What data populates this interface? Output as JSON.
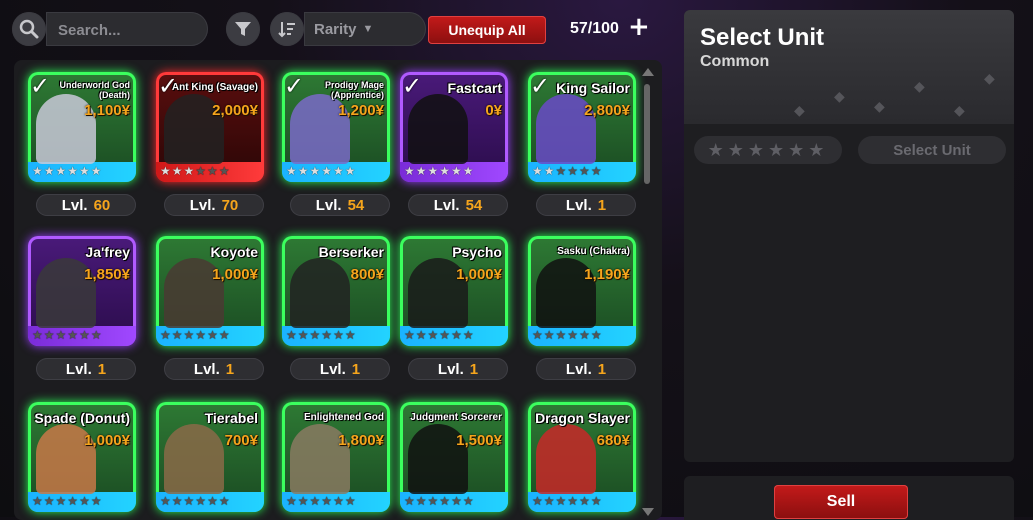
{
  "toolbar": {
    "search_placeholder": "Search...",
    "rarity_label": "Rarity",
    "unequip_label": "Unequip All",
    "count": "57/100",
    "add_label": "+"
  },
  "units": [
    {
      "name": "Underworld God (Death)",
      "price": "1,100¥",
      "level": "60",
      "rarity": "green",
      "stars_on": 6,
      "equipped": true
    },
    {
      "name": "Ant King (Savage)",
      "price": "2,000¥",
      "level": "70",
      "rarity": "red",
      "stars_on": 3,
      "equipped": true
    },
    {
      "name": "Prodigy Mage (Apprentice)",
      "price": "1,200¥",
      "level": "54",
      "rarity": "green",
      "stars_on": 6,
      "equipped": true
    },
    {
      "name": "Fastcart",
      "price": "0¥",
      "level": "54",
      "rarity": "purple",
      "stars_on": 6,
      "equipped": true
    },
    {
      "name": "King Sailor",
      "price": "2,800¥",
      "level": "1",
      "rarity": "green",
      "stars_on": 2,
      "equipped": true
    },
    {
      "name": "Ja'frey",
      "price": "1,850¥",
      "level": "1",
      "rarity": "purple",
      "stars_on": 0,
      "equipped": false
    },
    {
      "name": "Koyote",
      "price": "1,000¥",
      "level": "1",
      "rarity": "green",
      "stars_on": 0,
      "equipped": false
    },
    {
      "name": "Berserker",
      "price": "800¥",
      "level": "1",
      "rarity": "green",
      "stars_on": 0,
      "equipped": false
    },
    {
      "name": "Psycho",
      "price": "1,000¥",
      "level": "1",
      "rarity": "green",
      "stars_on": 0,
      "equipped": false
    },
    {
      "name": "Sasku (Chakra)",
      "price": "1,190¥",
      "level": "1",
      "rarity": "green",
      "stars_on": 0,
      "equipped": false
    },
    {
      "name": "Spade (Donut)",
      "price": "1,000¥",
      "level": "",
      "rarity": "green",
      "stars_on": 0,
      "equipped": false
    },
    {
      "name": "Tierabel",
      "price": "700¥",
      "level": "",
      "rarity": "green",
      "stars_on": 0,
      "equipped": false
    },
    {
      "name": "Enlightened God",
      "price": "1,800¥",
      "level": "",
      "rarity": "green",
      "stars_on": 0,
      "equipped": false
    },
    {
      "name": "Judgment Sorcerer",
      "price": "1,500¥",
      "level": "",
      "rarity": "green",
      "stars_on": 0,
      "equipped": false
    },
    {
      "name": "Dragon Slayer",
      "price": "680¥",
      "level": "",
      "rarity": "green",
      "stars_on": 0,
      "equipped": false
    }
  ],
  "level_prefix": "Lvl.",
  "side": {
    "title": "Select Unit",
    "subtitle": "Common",
    "select_label": "Select Unit",
    "sell_label": "Sell"
  }
}
